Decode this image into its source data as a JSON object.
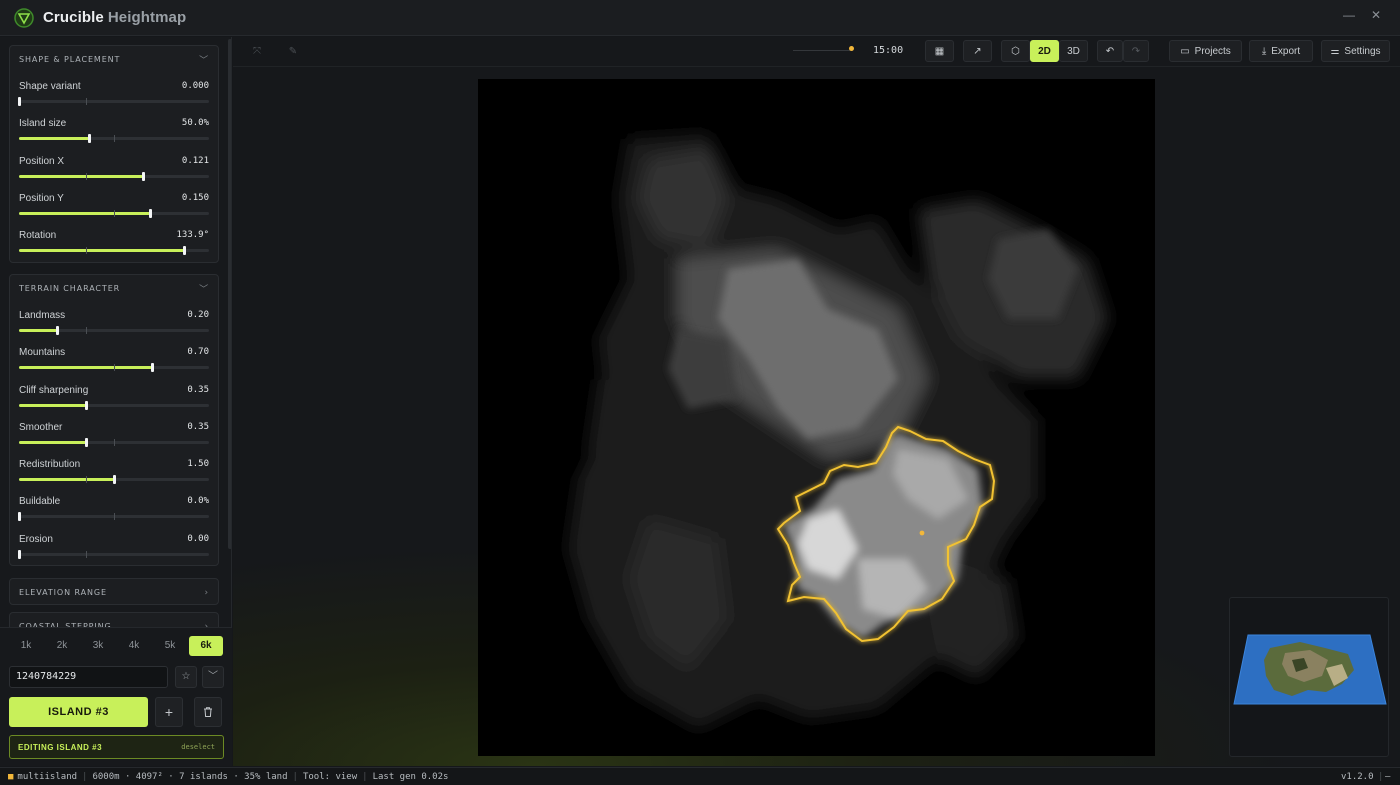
{
  "app": {
    "brand": "Crucible",
    "subtitle": "Heightmap",
    "accent": "#c8f05a",
    "highlight": "#f2c230"
  },
  "window": {
    "minimize_icon": "minimize-icon",
    "close_icon": "close-icon"
  },
  "panels": {
    "shape": {
      "title": "SHAPE & PLACEMENT",
      "sliders": [
        {
          "label": "Shape variant",
          "value": "0.000",
          "level": 0.0
        },
        {
          "label": "Island size",
          "value": "50.0%",
          "level": 0.37
        },
        {
          "label": "Position X",
          "value": "0.121",
          "level": 0.65
        },
        {
          "label": "Position Y",
          "value": "0.150",
          "level": 0.69
        },
        {
          "label": "Rotation",
          "value": "133.9°",
          "level": 0.87
        }
      ]
    },
    "terrain": {
      "title": "TERRAIN CHARACTER",
      "sliders": [
        {
          "label": "Landmass",
          "value": "0.20",
          "level": 0.2
        },
        {
          "label": "Mountains",
          "value": "0.70",
          "level": 0.7
        },
        {
          "label": "Cliff sharpening",
          "value": "0.35",
          "level": 0.35
        },
        {
          "label": "Smoother",
          "value": "0.35",
          "level": 0.35
        },
        {
          "label": "Redistribution",
          "value": "1.50",
          "level": 0.5
        },
        {
          "label": "Buildable",
          "value": "0.0%",
          "level": 0.0
        },
        {
          "label": "Erosion",
          "value": "0.00",
          "level": 0.0
        }
      ]
    },
    "elevation": {
      "title": "ELEVATION RANGE"
    },
    "coastal": {
      "title": "COASTAL STEPPING"
    }
  },
  "resolutions": [
    "1k",
    "2k",
    "3k",
    "4k",
    "5k",
    "6k"
  ],
  "active_resolution": "6k",
  "seed": "1240784229",
  "island_button": "ISLAND #3",
  "editing": {
    "label": "EDITING ISLAND #3",
    "action": "deselect"
  },
  "toolbar": {
    "time": "15:00",
    "view_2d": "2D",
    "view_3d": "3D",
    "projects": "Projects",
    "export": "Export",
    "settings": "Settings"
  },
  "status": {
    "mode": "multiisland",
    "map": "6000m · 4097² · 7 islands · 35% land",
    "tool": "Tool: view",
    "last_gen": "Last gen 0.02s",
    "version": "v1.2.0",
    "trailing": "—"
  }
}
